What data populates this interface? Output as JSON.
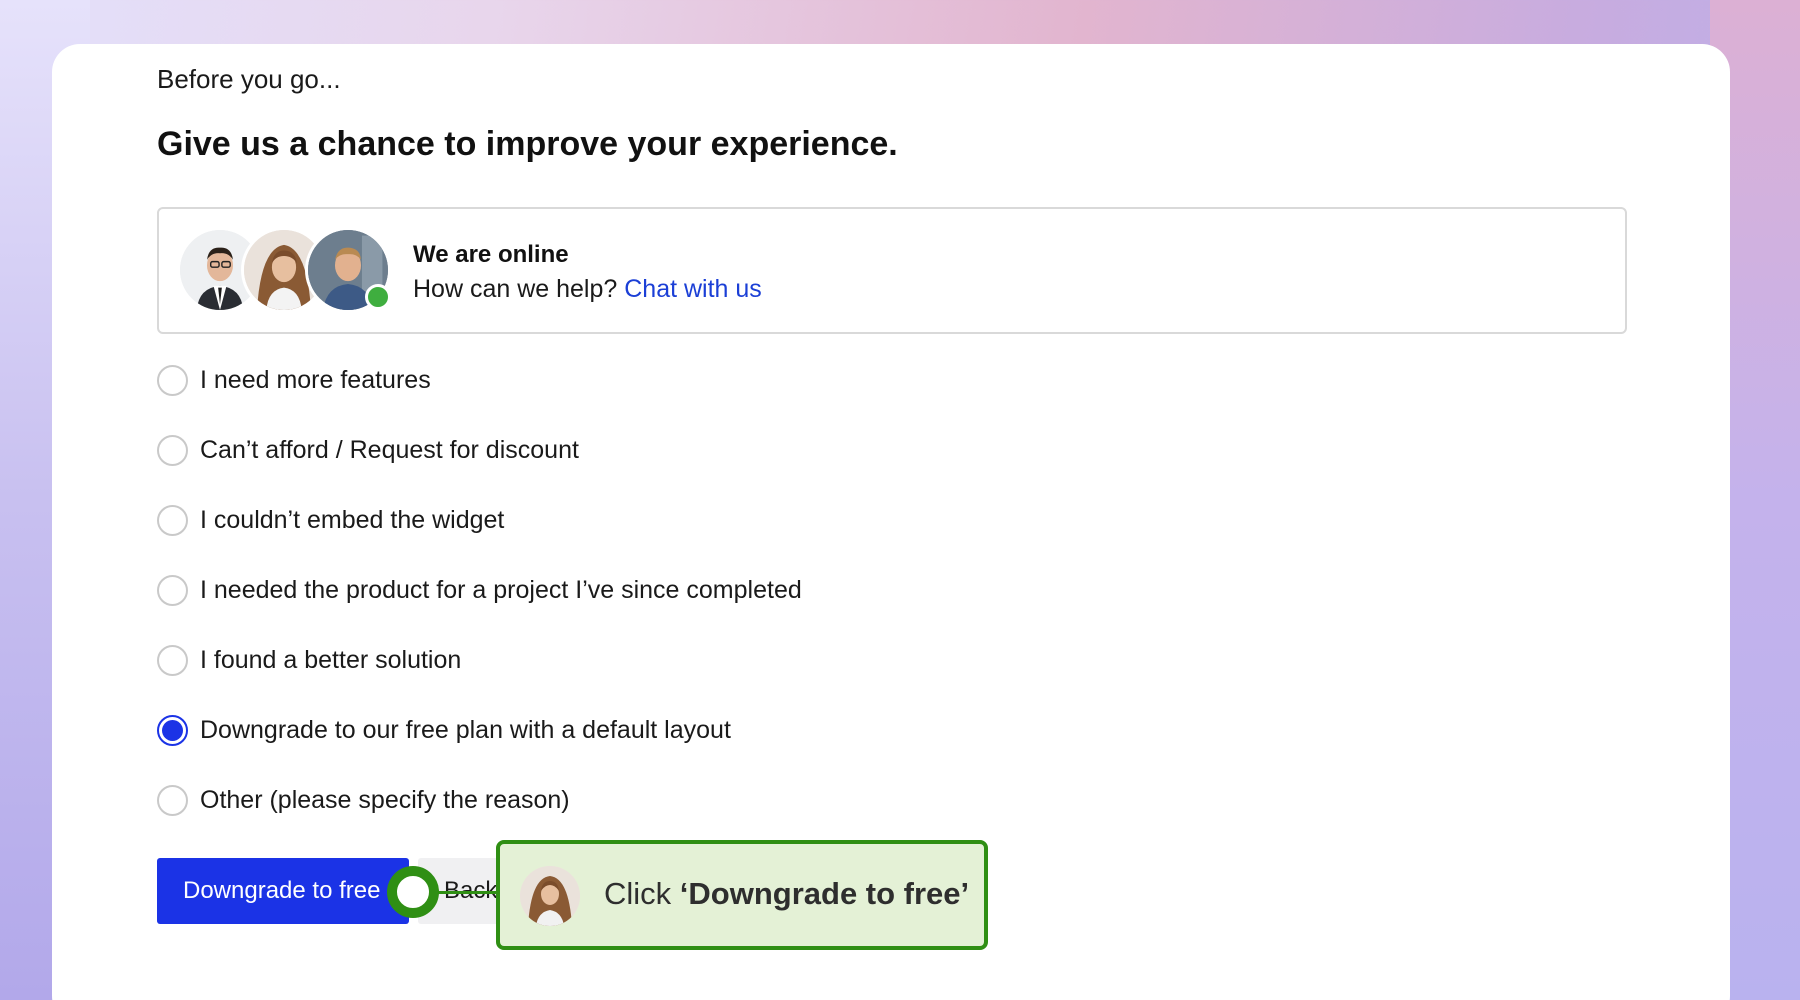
{
  "header": {
    "pre_title": "Before you go...",
    "title": "Give us a chance to improve your experience."
  },
  "support": {
    "status_title": "We are online",
    "help_text": "How can we help?",
    "chat_link": "Chat with us",
    "status_color": "#3fae3f"
  },
  "reasons": [
    {
      "label": "I need more features",
      "selected": false
    },
    {
      "label": "Can’t afford / Request for discount",
      "selected": false
    },
    {
      "label": "I couldn’t embed the widget",
      "selected": false
    },
    {
      "label": "I needed the product for a project I’ve since completed",
      "selected": false
    },
    {
      "label": "I found a better solution",
      "selected": false
    },
    {
      "label": "Downgrade to our free plan with a default layout",
      "selected": true
    },
    {
      "label": "Other (please specify the reason)",
      "selected": false
    }
  ],
  "actions": {
    "primary_label": "Downgrade to free",
    "back_label": "Back"
  },
  "hint": {
    "prefix": "Click ",
    "target": "‘Downgrade to free’"
  },
  "colors": {
    "accent": "#1b33e6",
    "hint_border": "#2f8f14",
    "hint_background": "#e4f1d6",
    "link": "#1b3fd6"
  }
}
